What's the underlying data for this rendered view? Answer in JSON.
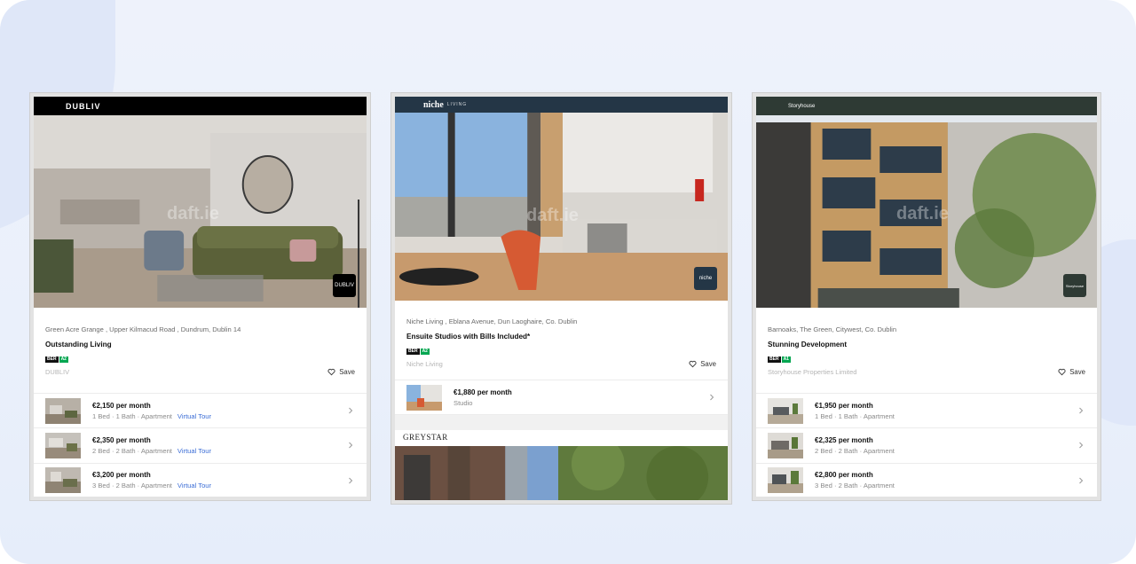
{
  "watermark": "daft.ie",
  "save_label": "Save",
  "cards": [
    {
      "brand": "DUBLIV",
      "badge_text": "DUBLIV",
      "address": "Green Acre Grange , Upper Kilmacud Road , Dundrum, Dublin 14",
      "title": "Outstanding Living",
      "ber_label": "BER",
      "ber_rating": "A2",
      "agent": "DUBLIV",
      "units": [
        {
          "price": "€2,150 per month",
          "details": "1 Bed · 1 Bath · Apartment",
          "tour": "Virtual Tour"
        },
        {
          "price": "€2,350 per month",
          "details": "2 Bed · 2 Bath · Apartment",
          "tour": "Virtual Tour"
        },
        {
          "price": "€3,200 per month",
          "details": "3 Bed · 2 Bath · Apartment",
          "tour": "Virtual Tour"
        }
      ]
    },
    {
      "brand": "niche",
      "brand_sub": "LIVING",
      "badge_text": "niche",
      "address": "Niche Living , Eblana Avenue, Dun Laoghaire, Co. Dublin",
      "title": "Ensuite Studios with Bills Included*",
      "ber_label": "BER",
      "ber_rating": "A2",
      "agent": "Niche Living",
      "units": [
        {
          "price": "€1,880 per month",
          "details": "Studio"
        }
      ],
      "next_brand": "GREYSTAR"
    },
    {
      "brand": "Storyhouse",
      "badge_text": "Storyhouse",
      "address": "Barnoaks, The Green, Citywest, Co. Dublin",
      "title": "Stunning Development",
      "ber_label": "BER",
      "ber_rating": "A1",
      "agent": "Storyhouse Properties Limited",
      "units": [
        {
          "price": "€1,950 per month",
          "details": "1 Bed · 1 Bath · Apartment"
        },
        {
          "price": "€2,325 per month",
          "details": "2 Bed · 2 Bath · Apartment"
        },
        {
          "price": "€2,800 per month",
          "details": "3 Bed · 2 Bath · Apartment"
        }
      ]
    }
  ]
}
